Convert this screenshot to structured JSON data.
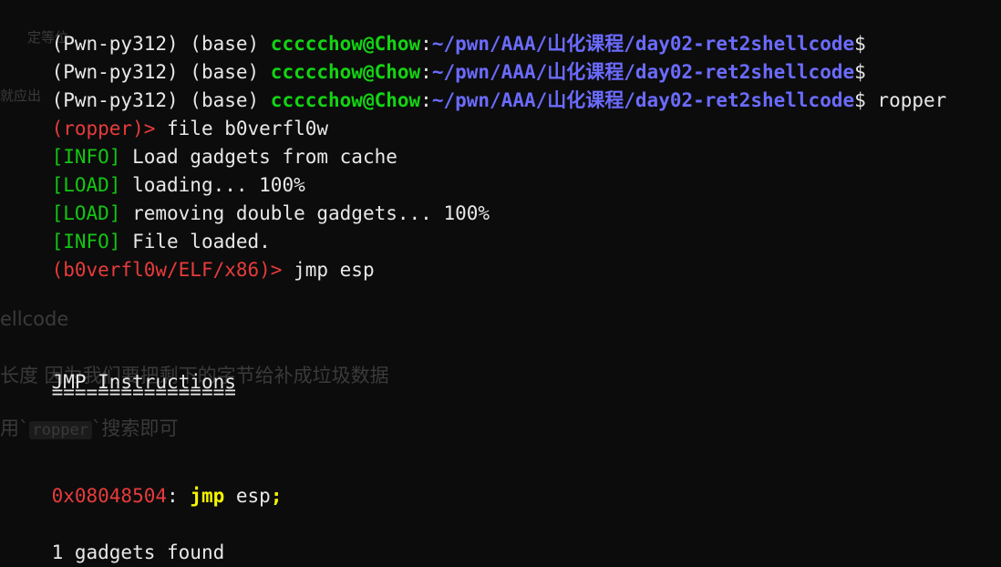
{
  "prompt": {
    "env": "(Pwn-py312) (base) ",
    "user_host": "ccccchow@Chow",
    "colon": ":",
    "path": "~/pwn/AAA/山化课程/day02-ret2shellcode",
    "dollar": "$"
  },
  "commands": {
    "line1_cmd": "",
    "line2_cmd": "",
    "line3_cmd": " ropper"
  },
  "ropper": {
    "prompt_plain": "(ropper)> ",
    "cmd_file": "file b0verfl0w",
    "info_tag": "[INFO]",
    "load_tag": "[LOAD]",
    "msg_cache": " Load gadgets from cache",
    "msg_loading": " loading... 100%",
    "msg_removing": " removing double gadgets... 100%",
    "msg_loaded": " File loaded.",
    "prompt_file": "(b0verfl0w/ELF/x86)> ",
    "cmd_jmp": "jmp esp"
  },
  "results": {
    "heading": "JMP Instructions",
    "underline": "================",
    "address": "0x08048504",
    "addr_colon": ": ",
    "mnemonic": "jmp",
    "operand": " esp",
    "semicolon": ";",
    "found": "1 gadgets found"
  },
  "ghost": {
    "shellcode": "ellcode",
    "length_note": "长度 因为我们要把剩下的字节给补成垃圾数据",
    "use_prefix": "用`",
    "use_code": "ropper",
    "use_suffix": "`搜索即可",
    "faint_top": "定等位",
    "faint_mid": "就应出"
  },
  "colors": {
    "background": "#0c0c0c",
    "user_green": "#13d413",
    "path_blue": "#6b6bff",
    "prompt_red": "#e83b3b",
    "tag_green": "#13c613",
    "mnemonic_yellow": "#f5f500",
    "text": "#e8e8e8"
  }
}
